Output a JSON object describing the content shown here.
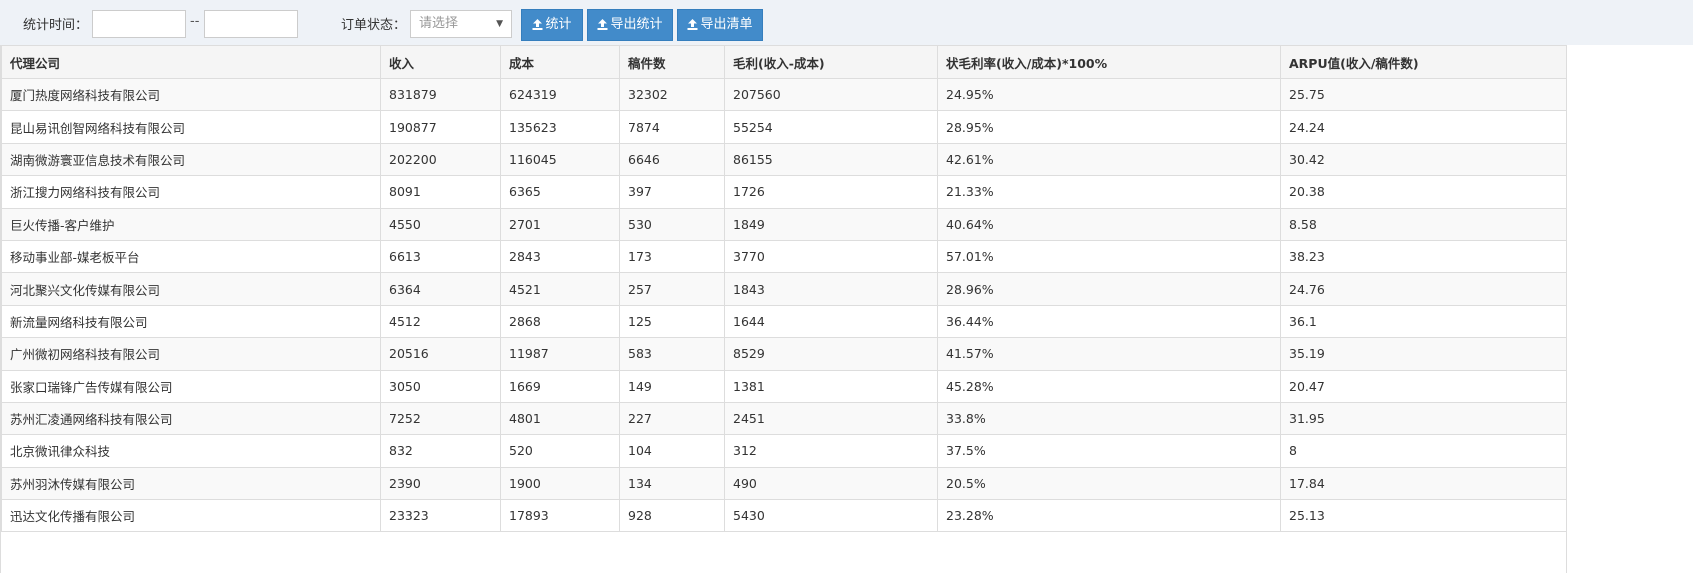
{
  "filters": {
    "time_label": "统计时间：",
    "start_date": "",
    "range_separator": "--",
    "end_date": "",
    "status_label": "订单状态：",
    "status_placeholder": "请选择"
  },
  "buttons": {
    "stats": "统计",
    "export_stats": "导出统计",
    "export_list": "导出清单"
  },
  "table": {
    "headers": [
      "代理公司",
      "收入",
      "成本",
      "稿件数",
      "毛利(收入-成本)",
      "状毛利率(收入/成本)*100%",
      "ARPU值(收入/稿件数)"
    ],
    "rows": [
      [
        "厦门热度网络科技有限公司",
        "831879",
        "624319",
        "32302",
        "207560",
        "24.95%",
        "25.75"
      ],
      [
        "昆山易讯创智网络科技有限公司",
        "190877",
        "135623",
        "7874",
        "55254",
        "28.95%",
        "24.24"
      ],
      [
        "湖南微游寰亚信息技术有限公司",
        "202200",
        "116045",
        "6646",
        "86155",
        "42.61%",
        "30.42"
      ],
      [
        "浙江搜力网络科技有限公司",
        "8091",
        "6365",
        "397",
        "1726",
        "21.33%",
        "20.38"
      ],
      [
        "巨火传播-客户维护",
        "4550",
        "2701",
        "530",
        "1849",
        "40.64%",
        "8.58"
      ],
      [
        "移动事业部-媒老板平台",
        "6613",
        "2843",
        "173",
        "3770",
        "57.01%",
        "38.23"
      ],
      [
        "河北聚兴文化传媒有限公司",
        "6364",
        "4521",
        "257",
        "1843",
        "28.96%",
        "24.76"
      ],
      [
        "新流量网络科技有限公司",
        "4512",
        "2868",
        "125",
        "1644",
        "36.44%",
        "36.1"
      ],
      [
        "广州微初网络科技有限公司",
        "20516",
        "11987",
        "583",
        "8529",
        "41.57%",
        "35.19"
      ],
      [
        "张家口瑞锋广告传媒有限公司",
        "3050",
        "1669",
        "149",
        "1381",
        "45.28%",
        "20.47"
      ],
      [
        "苏州汇凌通网络科技有限公司",
        "7252",
        "4801",
        "227",
        "2451",
        "33.8%",
        "31.95"
      ],
      [
        "北京微讯律众科技",
        "832",
        "520",
        "104",
        "312",
        "37.5%",
        "8"
      ],
      [
        "苏州羽沐传媒有限公司",
        "2390",
        "1900",
        "134",
        "490",
        "20.5%",
        "17.84"
      ],
      [
        "迅达文化传播有限公司",
        "23323",
        "17893",
        "928",
        "5430",
        "23.28%",
        "25.13"
      ]
    ]
  },
  "icons": {
    "upload": "upload-icon",
    "caret": "caret-down-icon"
  },
  "colors": {
    "primary_button": "#428bca",
    "toolbar_bg": "#eef2f7",
    "row_stripe": "#f9f9f9"
  }
}
